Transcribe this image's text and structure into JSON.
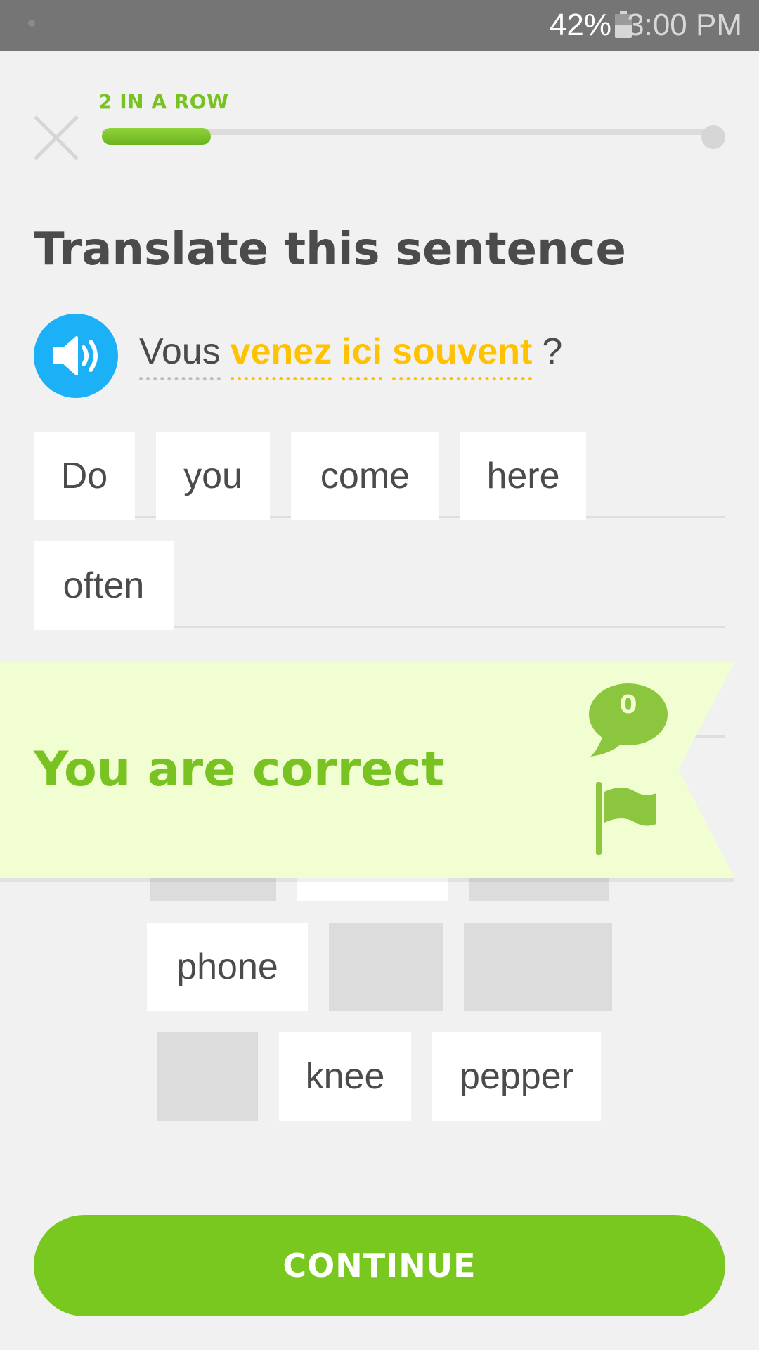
{
  "status_bar": {
    "battery": "42%",
    "time": "3:00 PM"
  },
  "header": {
    "streak_label": "2 IN A ROW",
    "progress_fraction": 0.15
  },
  "instruction": "Translate this sentence",
  "prompt": {
    "words": [
      "Vous",
      "venez",
      "ici",
      "souvent"
    ],
    "punctuation": "?"
  },
  "answer_tiles": [
    "Do",
    "you",
    "come",
    "here",
    "often"
  ],
  "word_bank": {
    "visible": [
      "phone",
      "knee",
      "pepper"
    ]
  },
  "result": {
    "message": "You are correct",
    "comment_count": "0"
  },
  "continue_label": "CONTINUE",
  "colors": {
    "accent_green": "#78c820",
    "hint_yellow": "#ffc200",
    "speaker_blue": "#1cb0f6",
    "banner_bg": "#f1fed2"
  }
}
